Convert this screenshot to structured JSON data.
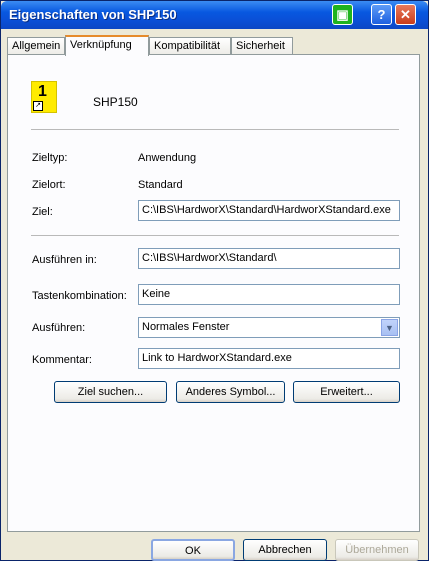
{
  "window": {
    "title": "Eigenschaften von SHP150"
  },
  "tabs": [
    {
      "label": "Allgemein"
    },
    {
      "label": "Verknüpfung"
    },
    {
      "label": "Kompatibilität"
    },
    {
      "label": "Sicherheit"
    }
  ],
  "shortcut": {
    "icon_label": "1",
    "name": "SHP150"
  },
  "fields": {
    "type_label": "Zieltyp:",
    "type_value": "Anwendung",
    "location_label": "Zielort:",
    "location_value": "Standard",
    "target_label": "Ziel:",
    "target_value": "C:\\IBS\\HardworX\\Standard\\HardworXStandard.exe",
    "start_in_label": "Ausführen in:",
    "start_in_value": "C:\\IBS\\HardworX\\Standard\\",
    "hotkey_label": "Tastenkombination:",
    "hotkey_value": "Keine",
    "run_label": "Ausführen:",
    "run_value": "Normales Fenster",
    "comment_label": "Kommentar:",
    "comment_value": "Link to HardworXStandard.exe"
  },
  "buttons": {
    "find_target": "Ziel suchen...",
    "change_icon": "Anderes Symbol...",
    "advanced": "Erweitert...",
    "ok": "OK",
    "cancel": "Abbrechen",
    "apply": "Übernehmen"
  },
  "icons": {
    "titlebar_green": "printer-icon",
    "help": "help-icon",
    "close": "close-icon",
    "shortcut": "application-shortcut-icon",
    "dropdown": "chevron-down-icon"
  }
}
